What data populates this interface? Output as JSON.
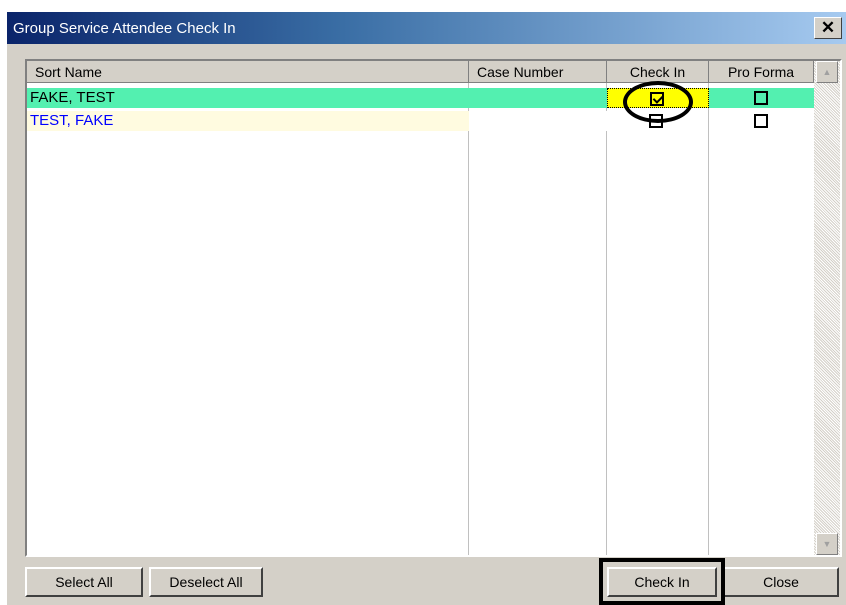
{
  "window": {
    "title": "Group Service Attendee Check In",
    "close_label": "✕"
  },
  "grid": {
    "columns": [
      "Sort Name",
      "Case Number",
      "Check In",
      "Pro Forma"
    ],
    "rows": [
      {
        "sort_name": "FAKE, TEST",
        "case_number": "",
        "check_in": true,
        "pro_forma": false
      },
      {
        "sort_name": "TEST, FAKE",
        "case_number": "",
        "check_in": false,
        "pro_forma": false
      }
    ]
  },
  "scrollbar": {
    "up_icon": "▲",
    "down_icon": "▼"
  },
  "buttons": {
    "select_all": "Select All",
    "deselect_all": "Deselect All",
    "check_in": "Check In",
    "close": "Close"
  },
  "colors": {
    "selected_row": "#53f0b0",
    "alt_row": "#fffbe0",
    "focused_cell": "#ffff00",
    "alt_row_text": "#0000ff"
  }
}
